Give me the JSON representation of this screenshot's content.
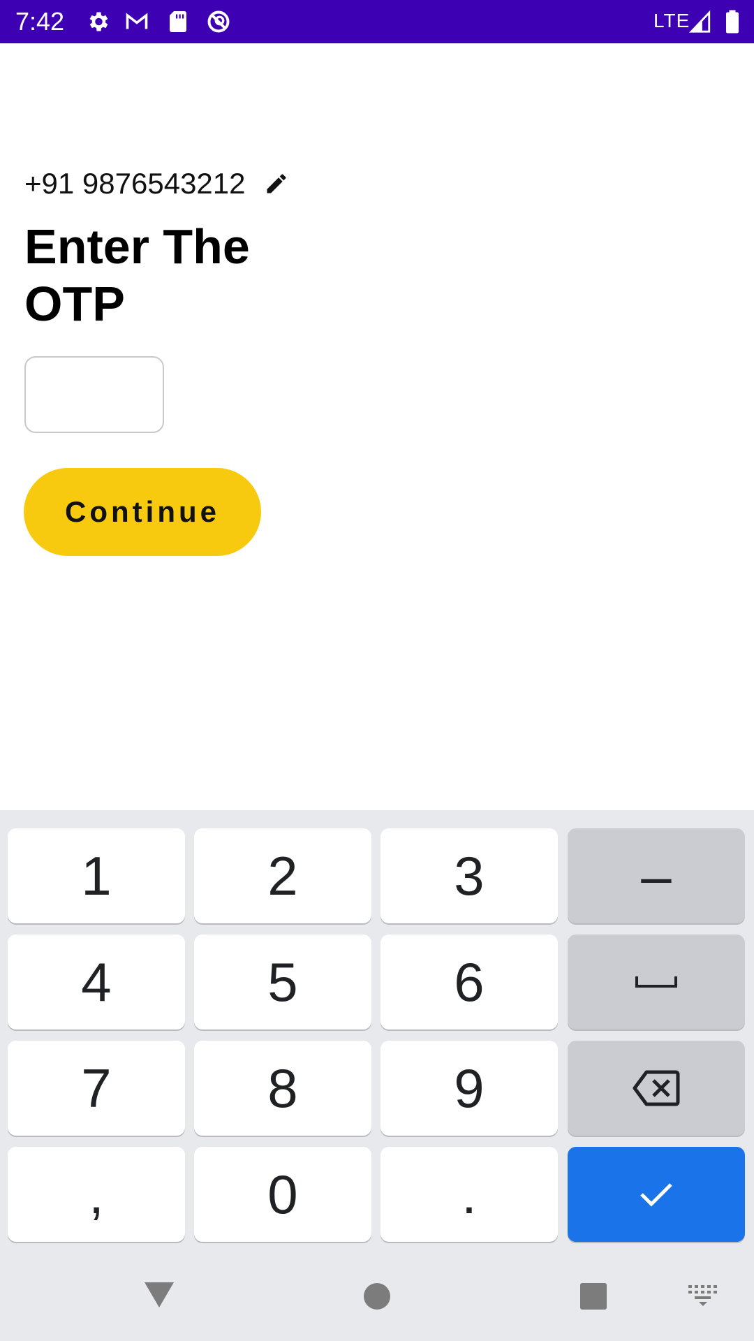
{
  "status_bar": {
    "time": "7:42",
    "network": "LTE",
    "icons": [
      "settings-icon",
      "gmail-icon",
      "sd-card-icon",
      "no-disturb-icon",
      "signal-icon",
      "battery-icon"
    ]
  },
  "otp_screen": {
    "phone_number": "+91 9876543212",
    "title": "Enter The OTP",
    "otp_value": "",
    "continue_label": "Continue"
  },
  "keyboard": {
    "rows": [
      [
        "1",
        "2",
        "3",
        "–"
      ],
      [
        "4",
        "5",
        "6",
        "space"
      ],
      [
        "7",
        "8",
        "9",
        "backspace"
      ],
      [
        ",",
        "0",
        ".",
        "enter"
      ]
    ],
    "key_1": "1",
    "key_2": "2",
    "key_3": "3",
    "key_dash": "–",
    "key_4": "4",
    "key_5": "5",
    "key_6": "6",
    "key_7": "7",
    "key_8": "8",
    "key_9": "9",
    "key_comma": ",",
    "key_0": "0",
    "key_period": "."
  },
  "colors": {
    "status_bar": "#3d00b3",
    "accent_button": "#f8ca0f",
    "keyboard_enter": "#1a73e8",
    "keyboard_bg": "#e8e9ec"
  }
}
